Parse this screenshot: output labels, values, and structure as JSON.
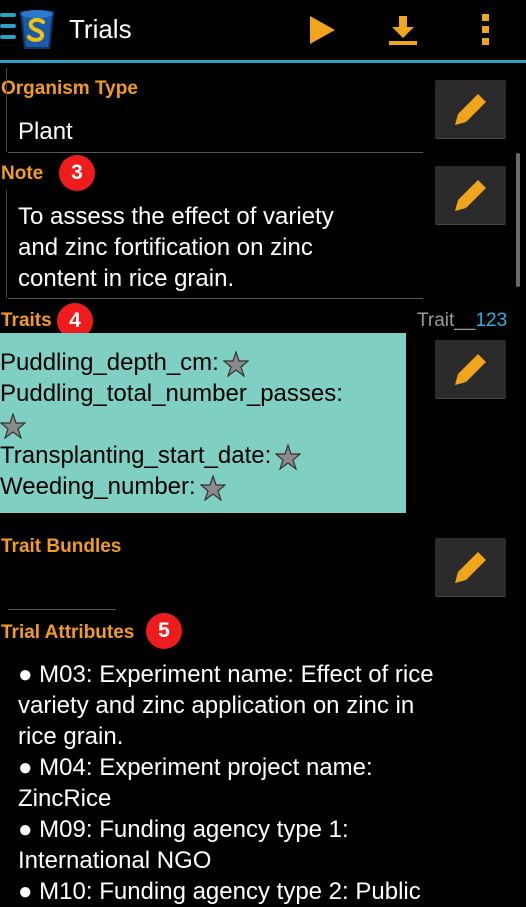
{
  "app": {
    "title": "Trials",
    "colors": {
      "accent": "#f39c1f",
      "badge": "#ee1c1c",
      "traits_bg": "#7fcfc3",
      "divider": "#2aa3c9"
    }
  },
  "toolbar": {
    "icons": [
      "menu-icon",
      "app-logo",
      "play-icon",
      "download-icon",
      "overflow-menu-icon"
    ]
  },
  "organism": {
    "label": "Organism Type",
    "value": "Plant"
  },
  "note": {
    "label": "Note",
    "badge": "3",
    "lines": [
      "To assess the effect of variety",
      "and zinc fortification on zinc",
      "content in rice grain."
    ]
  },
  "traits": {
    "label": "Traits",
    "badge": "4",
    "count_prefix": "Trait__",
    "count_value": "123",
    "items": [
      "Puddling_depth_cm:",
      "Puddling_total_number_passes:",
      "Transplanting_start_date:",
      "Weeding_number:"
    ]
  },
  "trait_bundles": {
    "label": "Trait Bundles"
  },
  "trial_attributes": {
    "label": "Trial Attributes",
    "badge": "5",
    "lines": [
      "● M03: Experiment name: Effect of rice",
      "variety and zinc application on zinc in",
      "rice grain.",
      "● M04: Experiment project name:",
      "ZincRice",
      "● M09: Funding agency type 1:",
      "International NGO",
      "● M10: Funding agency type 2: Public"
    ]
  }
}
